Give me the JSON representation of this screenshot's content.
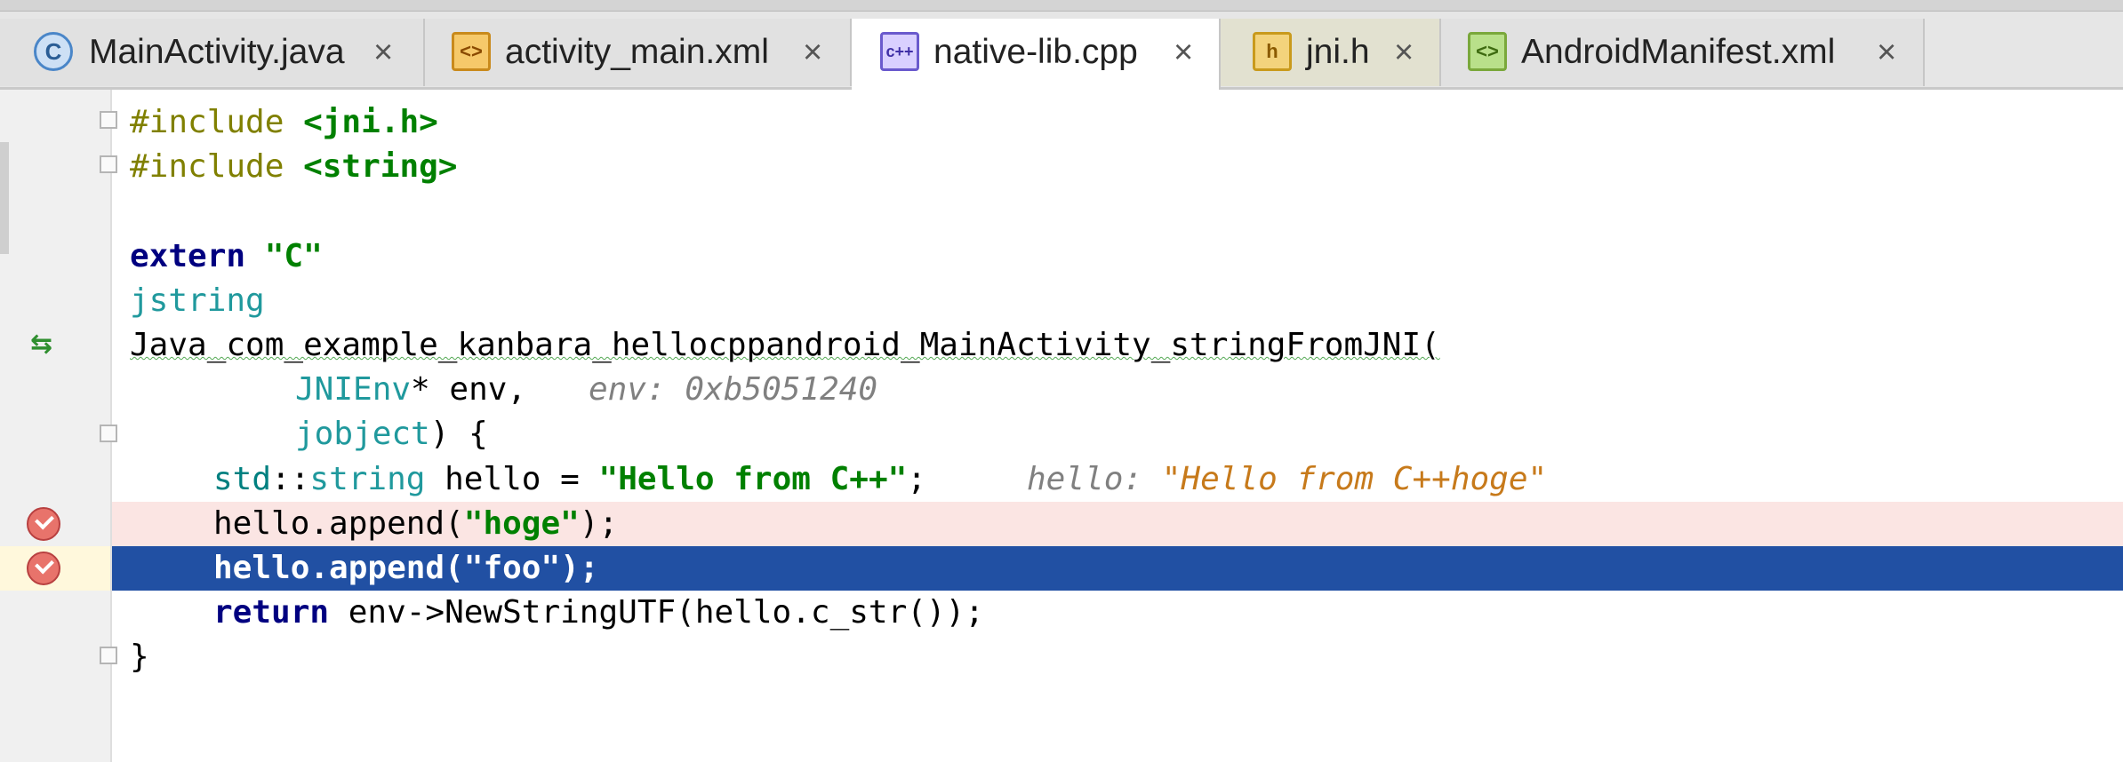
{
  "tabs": [
    {
      "label": "MainActivity.java",
      "icon": "java-class-icon",
      "icon_glyph": "C",
      "close": "×"
    },
    {
      "label": "activity_main.xml",
      "icon": "xml-layout-icon",
      "icon_glyph": "<>",
      "close": "×"
    },
    {
      "label": "native-lib.cpp",
      "icon": "cpp-file-icon",
      "icon_glyph": "c++",
      "close": "×"
    },
    {
      "label": "jni.h",
      "icon": "header-file-icon",
      "icon_glyph": "h",
      "close": "×"
    },
    {
      "label": "AndroidManifest.xml",
      "icon": "manifest-icon",
      "icon_glyph": "<>",
      "close": "×"
    }
  ],
  "active_tab": "native-lib.cpp",
  "editor": {
    "l1": {
      "pp": "#include ",
      "inc": "<jni.h>"
    },
    "l2": {
      "pp": "#include ",
      "inc": "<string>"
    },
    "l4": {
      "kw": "extern ",
      "str": "\"C\""
    },
    "l5": {
      "typ": "jstring"
    },
    "l6": {
      "text": "Java_com_example_kanbara_hellocppandroid_MainActivity_stringFromJNI("
    },
    "l7": {
      "typ": "JNIEnv",
      "rest": "* env,",
      "hint": "env: 0xb5051240"
    },
    "l8": {
      "typ": "jobject",
      "rest": ") {"
    },
    "l9": {
      "ns": "std",
      "sep": "::",
      "typ": "string",
      "mid": " hello = ",
      "str": "\"Hello from C++\"",
      "end": ";",
      "hint_label": "hello: ",
      "hint_val": "\"Hello from C++hoge\""
    },
    "l10": {
      "a": "hello.append(",
      "str": "\"hoge\"",
      "b": ");"
    },
    "l11": {
      "a": "hello.append(",
      "str": "\"foo\"",
      "b": ");"
    },
    "l12": {
      "kw": "return ",
      "rest": "env->NewStringUTF(hello.c_str());"
    },
    "l13": {
      "text": "}"
    }
  },
  "colors": {
    "selection": "#2150a3",
    "breakpoint_line": "#fbe5e3",
    "keyword": "#000080",
    "string": "#008000"
  }
}
